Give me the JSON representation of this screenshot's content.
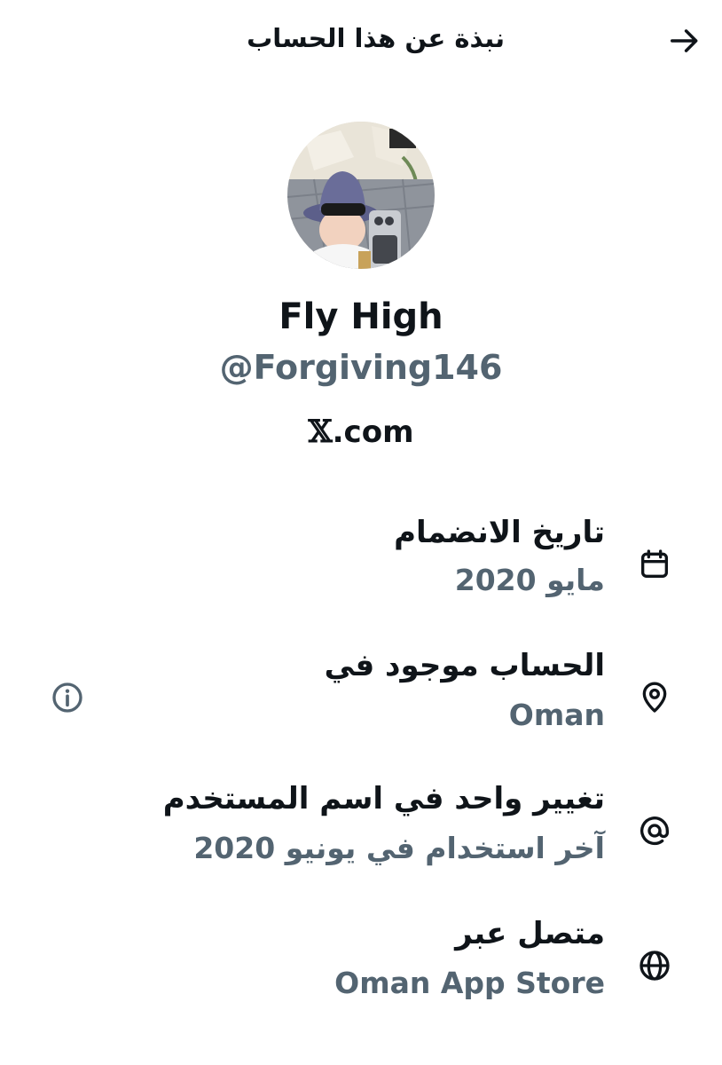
{
  "header": {
    "title": "نبذة عن هذا الحساب",
    "back_icon": "arrow-right-icon"
  },
  "profile": {
    "avatar": "profile-photo",
    "name": "Fly High",
    "handle": "@Forgiving146",
    "domain_logo": "𝕏",
    "domain_suffix": ".com"
  },
  "details": [
    {
      "icon": "calendar-icon",
      "title": "تاريخ الانضمام",
      "value": "مايو 2020"
    },
    {
      "icon": "location-pin-icon",
      "title": "الحساب موجود في",
      "value": "Oman",
      "info_icon": "info-icon"
    },
    {
      "icon": "at-sign-icon",
      "title": "تغيير واحد في اسم المستخدم",
      "value": "آخر استخدام في يونيو 2020"
    },
    {
      "icon": "globe-icon",
      "title": "متصل عبر",
      "value": "Oman App Store"
    }
  ],
  "colors": {
    "primary_text": "#0f1419",
    "secondary_text": "#536471",
    "background": "#ffffff"
  }
}
